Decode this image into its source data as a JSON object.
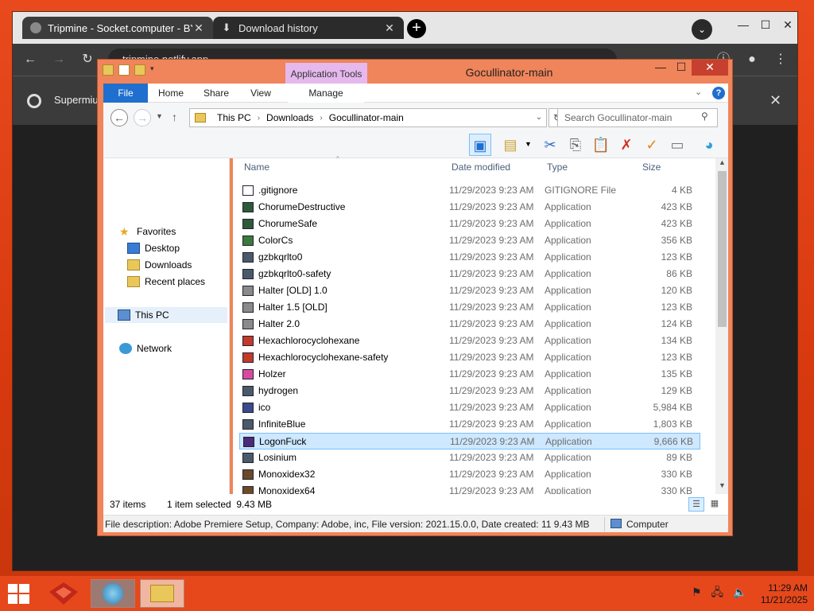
{
  "browser": {
    "tabs": [
      {
        "title": "Tripmine - Socket.computer - BY"
      },
      {
        "title": "Download history"
      }
    ],
    "address": "tripmine.netlify.app",
    "infobar_text": "Supermiu"
  },
  "explorer": {
    "window_title": "Gocullinator-main",
    "contextual_tab": "Application Tools",
    "ribbon_tabs": {
      "file": "File",
      "home": "Home",
      "share": "Share",
      "view": "View",
      "manage": "Manage"
    },
    "breadcrumb": [
      "This PC",
      "Downloads",
      "Gocullinator-main"
    ],
    "search_placeholder": "Search Gocullinator-main",
    "nav": {
      "favorites": "Favorites",
      "desktop": "Desktop",
      "downloads": "Downloads",
      "recent": "Recent places",
      "this_pc": "This PC",
      "network": "Network"
    },
    "columns": {
      "name": "Name",
      "date": "Date modified",
      "type": "Type",
      "size": "Size"
    },
    "files": [
      {
        "name": ".gitignore",
        "date": "11/29/2023 9:23 AM",
        "type": "GITIGNORE File",
        "size": "4 KB"
      },
      {
        "name": "ChorumeDestructive",
        "date": "11/29/2023 9:23 AM",
        "type": "Application",
        "size": "423 KB"
      },
      {
        "name": "ChorumeSafe",
        "date": "11/29/2023 9:23 AM",
        "type": "Application",
        "size": "423 KB"
      },
      {
        "name": "ColorCs",
        "date": "11/29/2023 9:23 AM",
        "type": "Application",
        "size": "356 KB"
      },
      {
        "name": "gzbkqrlto0",
        "date": "11/29/2023 9:23 AM",
        "type": "Application",
        "size": "123 KB"
      },
      {
        "name": "gzbkqrlto0-safety",
        "date": "11/29/2023 9:23 AM",
        "type": "Application",
        "size": "86 KB"
      },
      {
        "name": "Halter [OLD] 1.0",
        "date": "11/29/2023 9:23 AM",
        "type": "Application",
        "size": "120 KB"
      },
      {
        "name": "Halter 1.5 [OLD]",
        "date": "11/29/2023 9:23 AM",
        "type": "Application",
        "size": "123 KB"
      },
      {
        "name": "Halter 2.0",
        "date": "11/29/2023 9:23 AM",
        "type": "Application",
        "size": "124 KB"
      },
      {
        "name": "Hexachlorocyclohexane",
        "date": "11/29/2023 9:23 AM",
        "type": "Application",
        "size": "134 KB"
      },
      {
        "name": "Hexachlorocyclohexane-safety",
        "date": "11/29/2023 9:23 AM",
        "type": "Application",
        "size": "123 KB"
      },
      {
        "name": "Holzer",
        "date": "11/29/2023 9:23 AM",
        "type": "Application",
        "size": "135 KB"
      },
      {
        "name": "hydrogen",
        "date": "11/29/2023 9:23 AM",
        "type": "Application",
        "size": "129 KB"
      },
      {
        "name": "ico",
        "date": "11/29/2023 9:23 AM",
        "type": "Application",
        "size": "5,984 KB"
      },
      {
        "name": "InfiniteBlue",
        "date": "11/29/2023 9:23 AM",
        "type": "Application",
        "size": "1,803 KB"
      },
      {
        "name": "LogonFuck",
        "date": "11/29/2023 9:23 AM",
        "type": "Application",
        "size": "9,666 KB"
      },
      {
        "name": "Losinium",
        "date": "11/29/2023 9:23 AM",
        "type": "Application",
        "size": "89 KB"
      },
      {
        "name": "Monoxidex32",
        "date": "11/29/2023 9:23 AM",
        "type": "Application",
        "size": "330 KB"
      },
      {
        "name": "Monoxidex64",
        "date": "11/29/2023 9:23 AM",
        "type": "Application",
        "size": "330 KB"
      }
    ],
    "selected_index": 15,
    "status": {
      "count": "37 items",
      "selected": "1 item selected  9.43 MB"
    },
    "details_bar": {
      "description": "File description: Adobe Premiere Setup, Company: Adobe, inc, File version: 2021.15.0.0, Date created: 11 9.43 MB",
      "location": "Computer"
    }
  },
  "taskbar": {
    "time": "11:29 AM",
    "date": "11/21/2025"
  }
}
